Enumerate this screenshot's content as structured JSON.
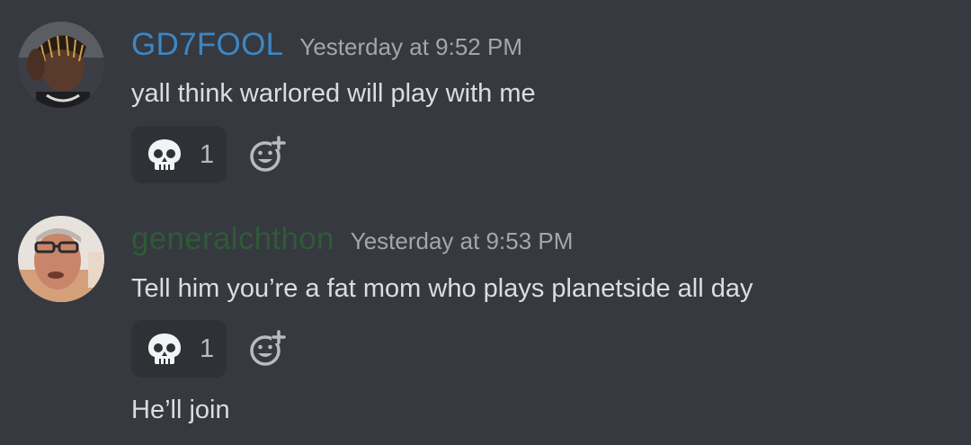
{
  "messages": [
    {
      "username": "GD7FOOL",
      "username_color": "#3e86c3",
      "timestamp": "Yesterday at 9:52 PM",
      "lines": [
        "yall think warlored will play with me"
      ],
      "reaction": {
        "icon": "skull-icon",
        "count": "1"
      }
    },
    {
      "username": "generalchthon",
      "username_color": "#2f5a37",
      "timestamp": "Yesterday at 9:53 PM",
      "lines": [
        "Tell him you’re a fat mom who plays planetside all day",
        "He’ll join"
      ],
      "reaction": {
        "icon": "skull-icon",
        "count": "1"
      }
    }
  ]
}
